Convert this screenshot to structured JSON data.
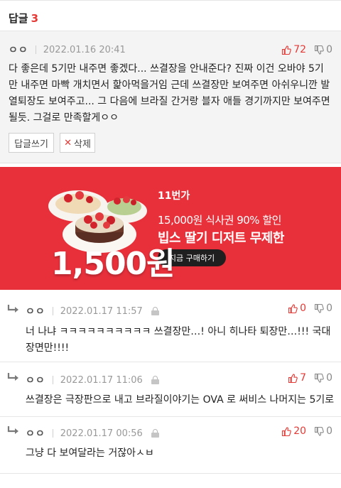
{
  "header": {
    "title": "답글",
    "count": "3"
  },
  "best": {
    "user": "ㅇㅇ",
    "date": "2022.01.16 20:41",
    "likes": "72",
    "dislikes": "0",
    "text": "다 좋은데 5기만 내주면 좋겠다... 쓰결장을 안내준다? 진짜 이건 오바야 5기만 내주면 마빡 개치면서 핥아먹을거임 근데 쓰결장만 보여주면 아쉬우니깐 발열퇴장도 보여주고... 그 다음에 브라질 간거랑 블자 애들 경기까지만 보여주면 될듯. 그걸로 만족할게ㅇㅇ",
    "reply_button": "답글쓰기",
    "delete_button": "삭제"
  },
  "ad": {
    "brand": "11번가",
    "subtitle": "15,000원 식사권 90% 할인",
    "headline": "빕스 딸기 디저트 무제한",
    "price": "1,500원",
    "cta": "지금 구매하기",
    "colors": {
      "background": "#e8303b"
    }
  },
  "replies": [
    {
      "user": "ㅇㅇ",
      "date": "2022.01.17 11:57",
      "likes": "0",
      "dislikes": "0",
      "text": "너 나냐 ㅋㅋㅋㅋㅋㅋㅋㅋㅋㅋ 쓰결장만…! 아니 히나타 퇴장만…!!! 국대 장면만!!!!"
    },
    {
      "user": "ㅇㅇ",
      "date": "2022.01.17 11:06",
      "likes": "7",
      "dislikes": "0",
      "text": "쓰결장은 극장판으로 내고 브라질이야기는 OVA 로 써비스 나머지는 5기로..."
    },
    {
      "user": "ㅇㅇ",
      "date": "2022.01.17 00:56",
      "likes": "20",
      "dislikes": "0",
      "text": "그냥 다 보여달라는 거잖아ㅅㅂ"
    }
  ],
  "icons": {
    "thumb_up": "thumb-up-icon",
    "thumb_down": "thumb-down-icon",
    "reply_arrow": "reply-arrow-icon",
    "lock": "lock-icon"
  },
  "colors": {
    "accent": "#e53935",
    "meta": "#999999",
    "best_bg": "#f4f4f4"
  }
}
